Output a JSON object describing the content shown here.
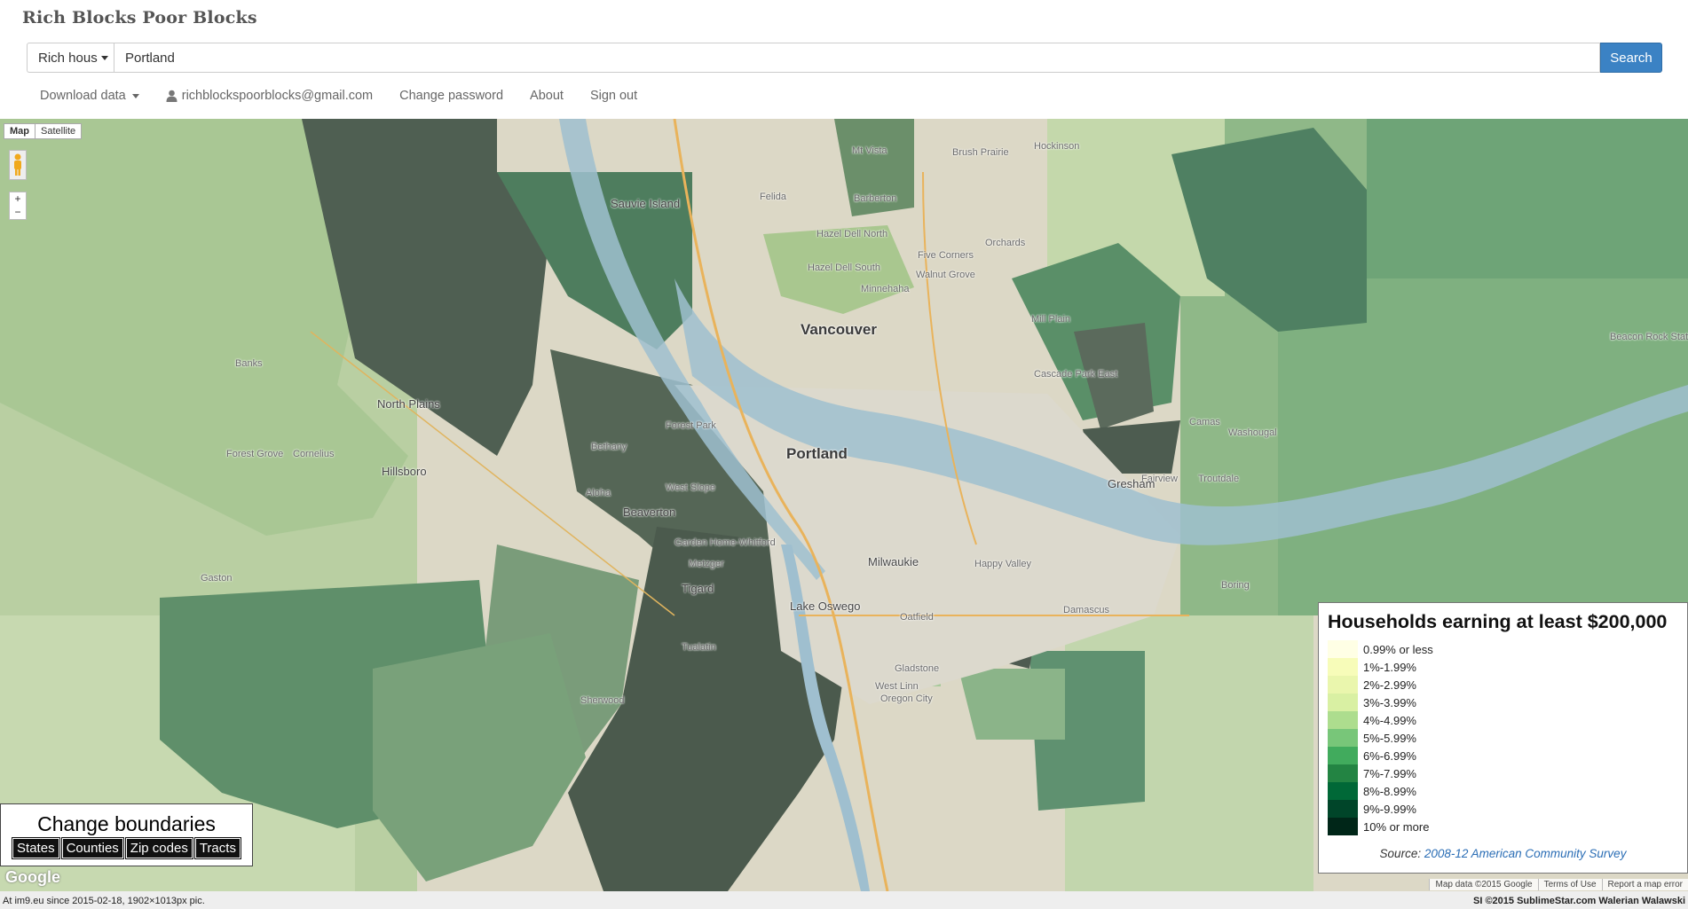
{
  "brand": "Rich Blocks Poor Blocks",
  "search": {
    "select_label": "Rich hous",
    "value": "Portland",
    "button": "Search"
  },
  "nav": {
    "download": "Download data",
    "email": "richblockspoorblocks@gmail.com",
    "change_password": "Change password",
    "about": "About",
    "sign_out": "Sign out"
  },
  "map_controls": {
    "map": "Map",
    "satellite": "Satellite",
    "zoom_in": "+",
    "zoom_out": "−"
  },
  "places": {
    "vancouver": "Vancouver",
    "portland": "Portland",
    "beaverton": "Beaverton",
    "hillsboro": "Hillsboro",
    "gresham": "Gresham",
    "tigard": "Tigard",
    "lake_oswego": "Lake Oswego",
    "milwaukie": "Milwaukie",
    "happy_valley": "Happy Valley",
    "sauvie_island": "Sauvie Island",
    "north_plains": "North Plains",
    "banks": "Banks",
    "camas": "Camas",
    "washougal": "Washougal",
    "troutdale": "Troutdale",
    "fairview": "Fairview",
    "damascus": "Damascus",
    "boring": "Boring",
    "oregon_city": "Oregon City",
    "west_linn": "West Linn",
    "tualatin": "Tualatin",
    "sherwood": "Sherwood",
    "gaston": "Gaston",
    "forest_grove": "Forest Grove",
    "cornelius": "Cornelius",
    "aloha": "Aloha",
    "mt_vista": "Mt Vista",
    "hockinson": "Hockinson",
    "brush_prairie": "Brush Prairie",
    "felida": "Felida",
    "barberton": "Barberton",
    "mill_plain": "Mill Plain",
    "beacon_rock": "Beacon Rock Stat",
    "hazel_dell_north": "Hazel Dell North",
    "hazel_dell_south": "Hazel Dell South",
    "minnehaha": "Minnehaha",
    "walnut_grove": "Walnut Grove",
    "orchards": "Orchards",
    "five_corners": "Five Corners",
    "bethany": "Bethany",
    "forest_park": "Forest Park",
    "west_slope": "West Slope",
    "metzger": "Metzger",
    "garden_home_whitford": "Garden Home-Whitford",
    "gladstone": "Gladstone",
    "oatfield": "Oatfield",
    "cascade_park_east": "Cascade Park East"
  },
  "boundaries": {
    "title": "Change boundaries",
    "states": "States",
    "counties": "Counties",
    "zip_codes": "Zip codes",
    "tracts": "Tracts"
  },
  "legend": {
    "title": "Households earning at least $200,000",
    "items": [
      {
        "label": "0.99% or less",
        "color": "#ffffe5"
      },
      {
        "label": "1%-1.99%",
        "color": "#f7fcb9"
      },
      {
        "label": "2%-2.99%",
        "color": "#eaf6ad"
      },
      {
        "label": "3%-3.99%",
        "color": "#d9f0a3"
      },
      {
        "label": "4%-4.99%",
        "color": "#addd8e"
      },
      {
        "label": "5%-5.99%",
        "color": "#78c679"
      },
      {
        "label": "6%-6.99%",
        "color": "#41ab5d"
      },
      {
        "label": "7%-7.99%",
        "color": "#238443"
      },
      {
        "label": "8%-8.99%",
        "color": "#006837"
      },
      {
        "label": "9%-9.99%",
        "color": "#004529"
      },
      {
        "label": "10% or more",
        "color": "#002618"
      }
    ],
    "source_prefix": "Source:",
    "source_link": "2008-12 American Community Survey"
  },
  "map_footer": {
    "google": "Google",
    "map_data": "Map data ©2015 Google",
    "terms": "Terms of Use",
    "report": "Report a map error"
  },
  "image_footer": {
    "left": "At im9.eu since 2015-02-18, 1902×1013px pic.",
    "right": "SI ©2015 SublimeStar.com Walerian Walawski"
  }
}
